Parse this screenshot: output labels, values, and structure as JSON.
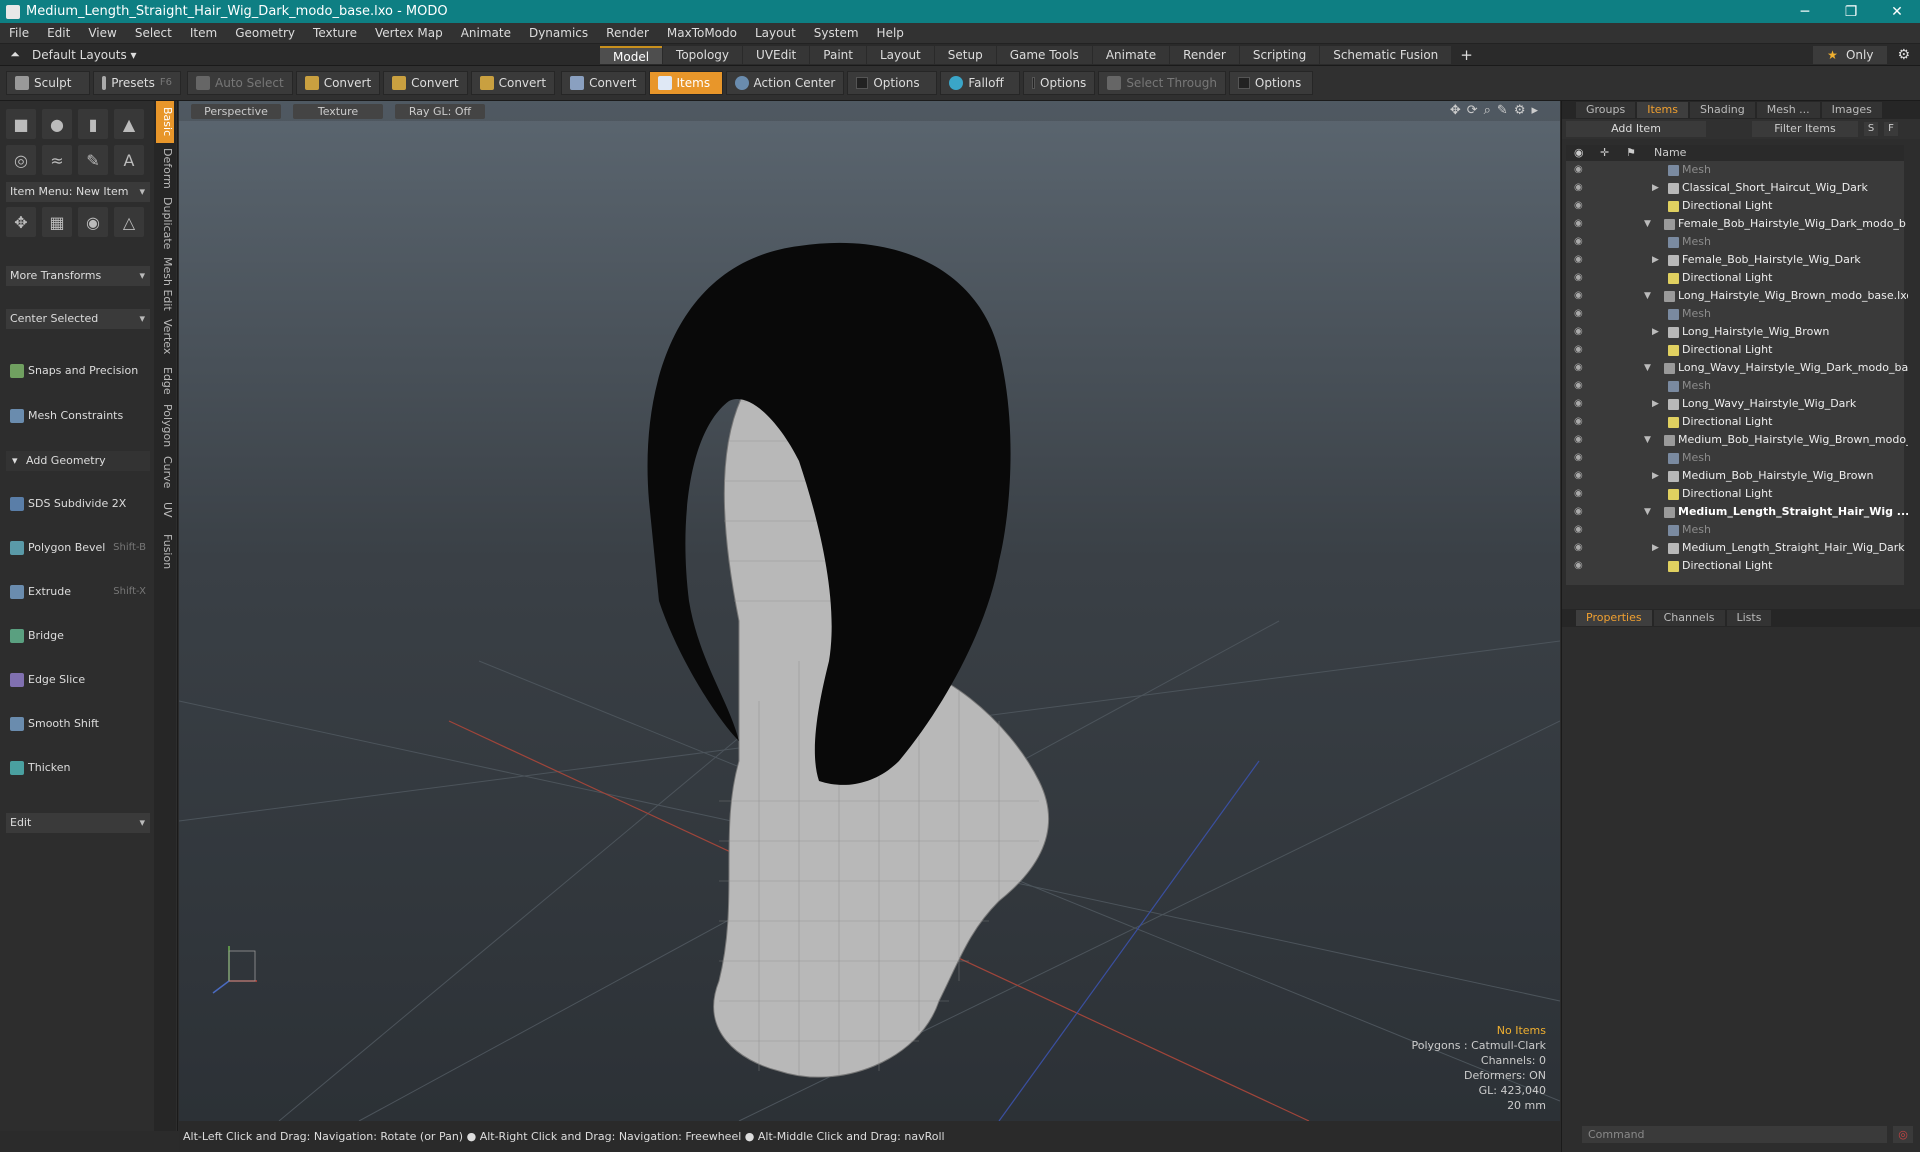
{
  "window": {
    "title": "Medium_Length_Straight_Hair_Wig_Dark_modo_base.lxo - MODO",
    "minimize": "─",
    "restore": "❐",
    "close": "✕"
  },
  "menu": [
    "File",
    "Edit",
    "View",
    "Select",
    "Item",
    "Geometry",
    "Texture",
    "Vertex Map",
    "Animate",
    "Dynamics",
    "Render",
    "MaxToModo",
    "Layout",
    "System",
    "Help"
  ],
  "layout": {
    "preset": "Default Layouts ▾",
    "tabs": [
      "Model",
      "Topology",
      "UVEdit",
      "Paint",
      "Layout",
      "Setup",
      "Game Tools",
      "Animate",
      "Render",
      "Scripting",
      "Schematic Fusion"
    ],
    "active_tab": "Model",
    "plus": "+",
    "only": "Only",
    "only_star": "★",
    "gear": "⚙"
  },
  "toolbar": {
    "sculpt": "Sculpt",
    "presets": "Presets",
    "presets_key": "F6",
    "auto_select": "Auto Select",
    "convert": "Convert",
    "items": "Items",
    "action_center": "Action Center",
    "options": "Options",
    "falloff": "Falloff",
    "select_through": "Select Through"
  },
  "left": {
    "item_menu": "Item Menu: New Item",
    "more_transforms": "More Transforms",
    "center_selected": "Center Selected",
    "snaps": "Snaps and Precision",
    "mesh_constraints": "Mesh Constraints",
    "add_geometry": "Add Geometry",
    "tools": [
      {
        "label": "SDS Subdivide 2X",
        "key": ""
      },
      {
        "label": "Polygon Bevel",
        "key": "Shift-B"
      },
      {
        "label": "Extrude",
        "key": "Shift-X"
      },
      {
        "label": "Bridge",
        "key": ""
      },
      {
        "label": "Edge Slice",
        "key": ""
      },
      {
        "label": "Smooth Shift",
        "key": ""
      },
      {
        "label": "Thicken",
        "key": ""
      }
    ],
    "edit": "Edit",
    "vtabs": [
      "Basic",
      "Deform",
      "Duplicate",
      "Mesh Edit",
      "Vertex",
      "Edge",
      "Polygon",
      "Curve",
      "UV",
      "Fusion"
    ]
  },
  "viewport": {
    "view": "Perspective",
    "shading": "Texture",
    "raygl": "Ray GL: Off",
    "info": {
      "items": "No Items",
      "polygons": "Polygons : Catmull-Clark",
      "channels": "Channels: 0",
      "deformers": "Deformers: ON",
      "gl": "GL: 423,040",
      "mm": "20 mm"
    }
  },
  "status": "Alt-Left Click and Drag: Navigation: Rotate (or Pan) ● Alt-Right Click and Drag: Navigation: Freewheel ● Alt-Middle Click and Drag: navRoll",
  "right": {
    "tabs": [
      "Groups",
      "Items",
      "Shading",
      "Mesh ...",
      "Images"
    ],
    "active_tab": "Items",
    "add_item": "Add Item",
    "filter": "Filter Items",
    "s_btn": "S",
    "f_btn": "F",
    "col_name": "Name",
    "rows": [
      {
        "label": "Mesh",
        "indent": 2,
        "kind": "mesh",
        "dim": true
      },
      {
        "label": "Classical_Short_Haircut_Wig_Dark",
        "indent": 2,
        "kind": "group",
        "tri": "▶"
      },
      {
        "label": "Directional Light",
        "indent": 2,
        "kind": "light"
      },
      {
        "label": "Female_Bob_Hairstyle_Wig_Dark_modo_b ...",
        "indent": 1,
        "kind": "scene",
        "tri": "▼"
      },
      {
        "label": "Mesh",
        "indent": 2,
        "kind": "mesh",
        "dim": true
      },
      {
        "label": "Female_Bob_Hairstyle_Wig_Dark",
        "indent": 2,
        "kind": "group",
        "tri": "▶"
      },
      {
        "label": "Directional Light",
        "indent": 2,
        "kind": "light"
      },
      {
        "label": "Long_Hairstyle_Wig_Brown_modo_base.lxo",
        "indent": 1,
        "kind": "scene",
        "tri": "▼"
      },
      {
        "label": "Mesh",
        "indent": 2,
        "kind": "mesh",
        "dim": true
      },
      {
        "label": "Long_Hairstyle_Wig_Brown",
        "indent": 2,
        "kind": "group",
        "tri": "▶"
      },
      {
        "label": "Directional Light",
        "indent": 2,
        "kind": "light"
      },
      {
        "label": "Long_Wavy_Hairstyle_Wig_Dark_modo_ba...",
        "indent": 1,
        "kind": "scene",
        "tri": "▼"
      },
      {
        "label": "Mesh",
        "indent": 2,
        "kind": "mesh",
        "dim": true
      },
      {
        "label": "Long_Wavy_Hairstyle_Wig_Dark",
        "indent": 2,
        "kind": "group",
        "tri": "▶"
      },
      {
        "label": "Directional Light",
        "indent": 2,
        "kind": "light"
      },
      {
        "label": "Medium_Bob_Hairstyle_Wig_Brown_modo_...",
        "indent": 1,
        "kind": "scene",
        "tri": "▼"
      },
      {
        "label": "Mesh",
        "indent": 2,
        "kind": "mesh",
        "dim": true
      },
      {
        "label": "Medium_Bob_Hairstyle_Wig_Brown",
        "indent": 2,
        "kind": "group",
        "tri": "▶"
      },
      {
        "label": "Directional Light",
        "indent": 2,
        "kind": "light"
      },
      {
        "label": "Medium_Length_Straight_Hair_Wig ...",
        "indent": 1,
        "kind": "scene",
        "tri": "▼",
        "bold": true
      },
      {
        "label": "Mesh",
        "indent": 2,
        "kind": "mesh",
        "dim": true
      },
      {
        "label": "Medium_Length_Straight_Hair_Wig_Dark",
        "indent": 2,
        "kind": "group",
        "tri": "▶"
      },
      {
        "label": "Directional Light",
        "indent": 2,
        "kind": "light"
      }
    ],
    "prop_tabs": [
      "Properties",
      "Channels",
      "Lists"
    ],
    "prop_active": "Properties",
    "command": "Command"
  },
  "colors": {
    "accent": "#e8962a",
    "titlebar": "#0e7f83",
    "active_label": "#f0a030"
  }
}
